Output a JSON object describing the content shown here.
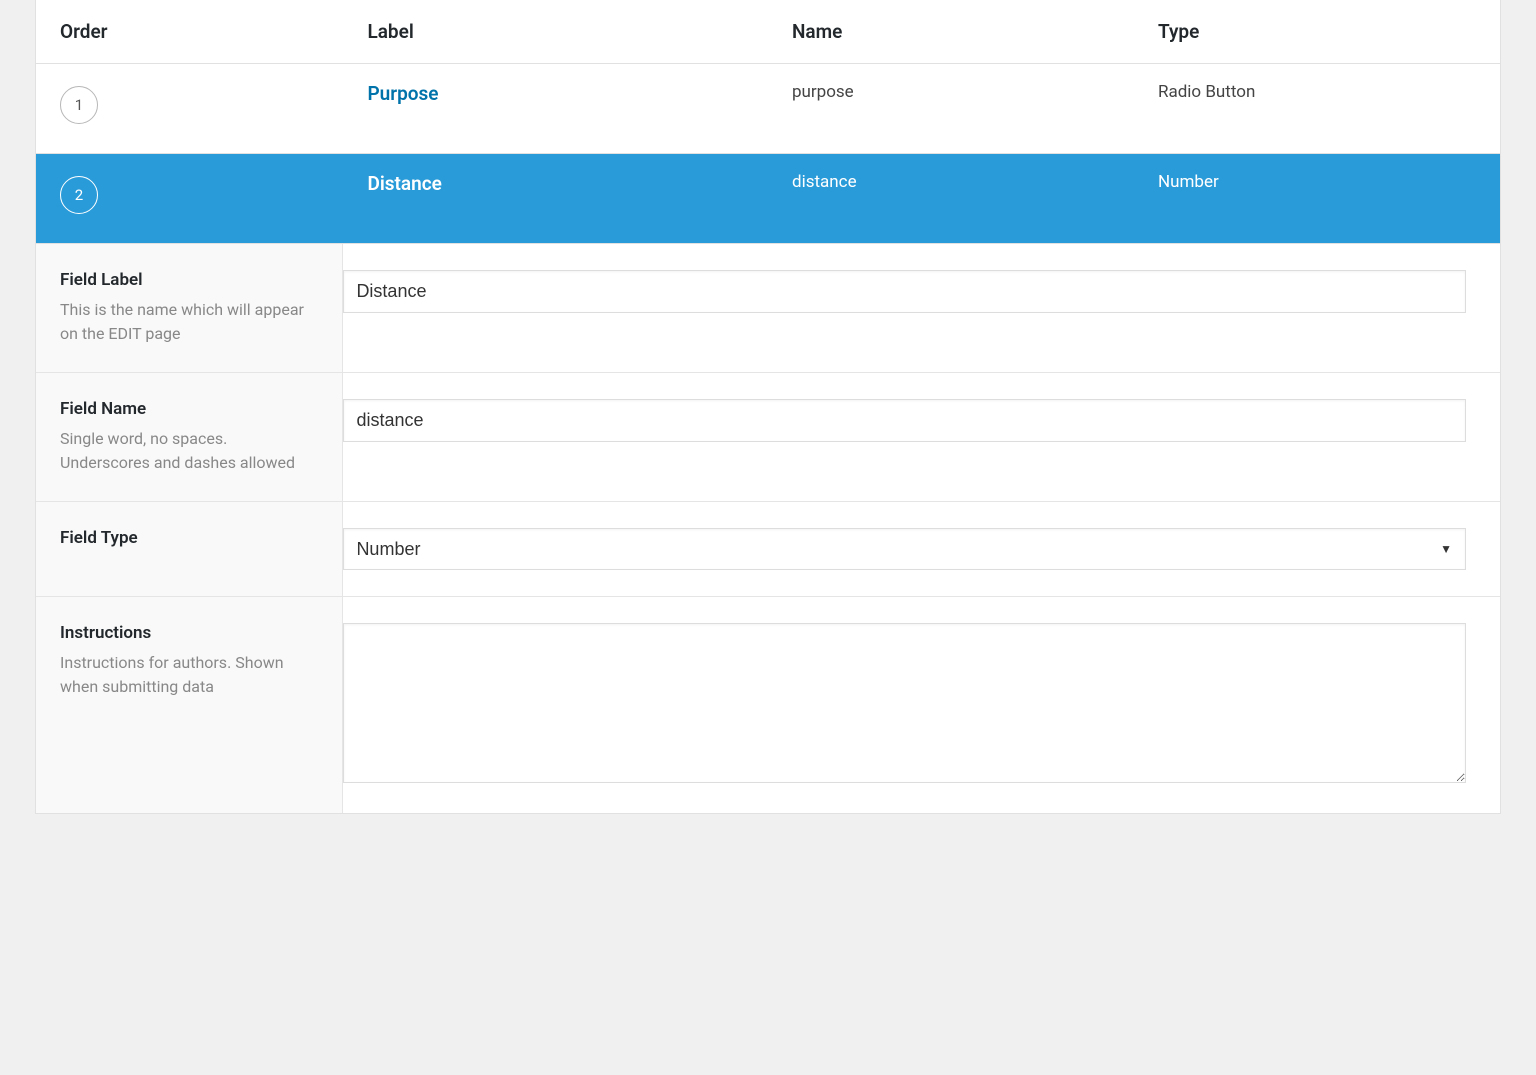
{
  "headers": {
    "order": "Order",
    "label": "Label",
    "name": "Name",
    "type": "Type"
  },
  "fields": [
    {
      "order": "1",
      "label": "Purpose",
      "name": "purpose",
      "type": "Radio Button"
    },
    {
      "order": "2",
      "label": "Distance",
      "name": "distance",
      "type": "Number"
    }
  ],
  "settings": {
    "fieldLabel": {
      "title": "Field Label",
      "desc": "This is the name which will appear on the EDIT page",
      "value": "Distance"
    },
    "fieldName": {
      "title": "Field Name",
      "desc": "Single word, no spaces. Underscores and dashes allowed",
      "value": "distance"
    },
    "fieldType": {
      "title": "Field Type",
      "value": "Number"
    },
    "instructions": {
      "title": "Instructions",
      "desc": "Instructions for authors. Shown when submitting data",
      "value": ""
    }
  }
}
